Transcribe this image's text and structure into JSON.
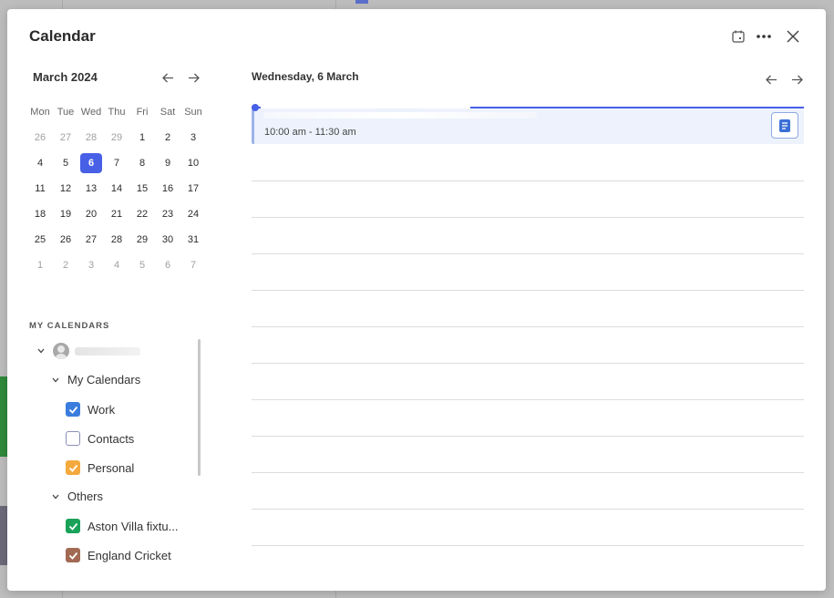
{
  "modal": {
    "title": "Calendar",
    "icons": {
      "today": "calendar-today-icon",
      "more": "more-horizontal-icon",
      "close": "close-icon"
    }
  },
  "mini_calendar": {
    "month_label": "March 2024",
    "weekdays": [
      "Mon",
      "Tue",
      "Wed",
      "Thu",
      "Fri",
      "Sat",
      "Sun"
    ],
    "weeks": [
      [
        "26",
        "27",
        "28",
        "29",
        "1",
        "2",
        "3"
      ],
      [
        "4",
        "5",
        "6",
        "7",
        "8",
        "9",
        "10"
      ],
      [
        "11",
        "12",
        "13",
        "14",
        "15",
        "16",
        "17"
      ],
      [
        "18",
        "19",
        "20",
        "21",
        "22",
        "23",
        "24"
      ],
      [
        "25",
        "26",
        "27",
        "28",
        "29",
        "30",
        "31"
      ],
      [
        "1",
        "2",
        "3",
        "4",
        "5",
        "6",
        "7"
      ]
    ],
    "selected_day": "6"
  },
  "my_calendars": {
    "section_title": "MY CALENDARS",
    "group_my": "My Calendars",
    "group_others": "Others",
    "items": [
      {
        "label": "Work",
        "checked": true,
        "color": "#3b7ddd"
      },
      {
        "label": "Contacts",
        "checked": false,
        "color": "#8a8fb8"
      },
      {
        "label": "Personal",
        "checked": true,
        "color": "#f4a93d"
      },
      {
        "label": "Aston Villa fixtu...",
        "checked": true,
        "color": "#1aa259"
      },
      {
        "label": "England Cricket",
        "checked": true,
        "color": "#a26a53"
      }
    ]
  },
  "day_view": {
    "date_label": "Wednesday, 6 March",
    "event": {
      "time": "10:00 am - 11:30 am",
      "color": "#edf2fc",
      "accent": "#4760e6"
    }
  }
}
